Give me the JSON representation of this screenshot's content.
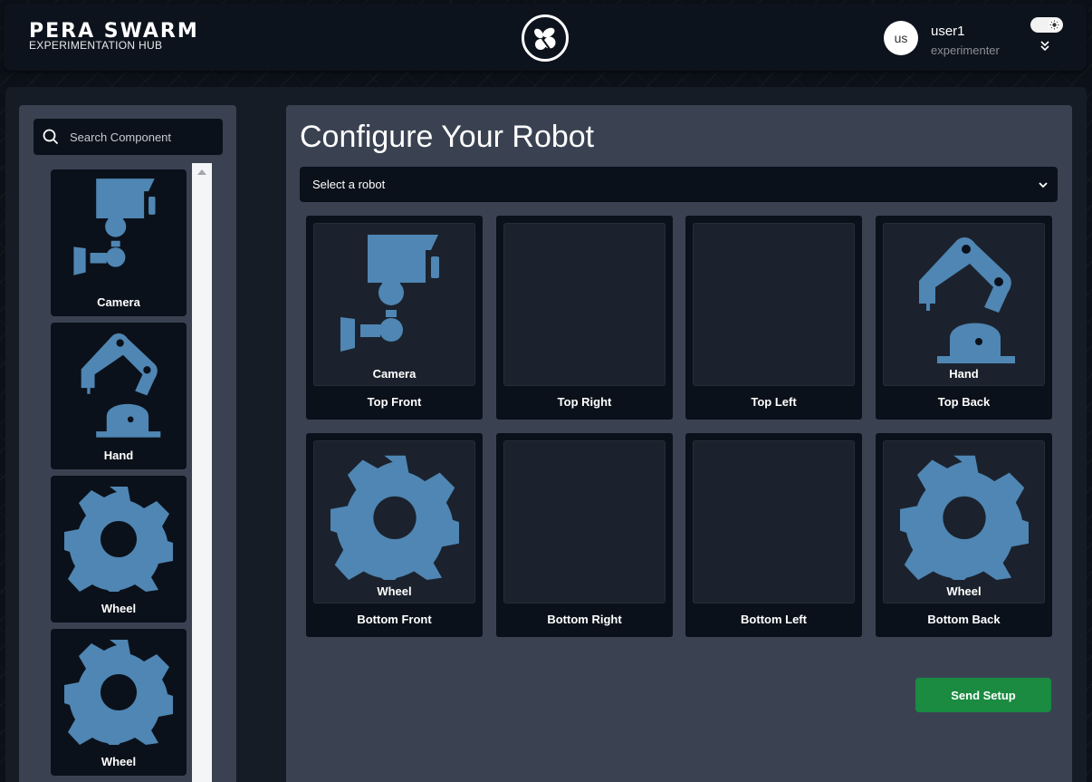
{
  "header": {
    "brand_title": "PERA SWARM",
    "brand_subtitle": "EXPERIMENTATION HUB",
    "avatar_initials": "us",
    "user_name": "user1",
    "user_role": "experimenter"
  },
  "sidebar": {
    "search_placeholder": "Search Component",
    "components": [
      {
        "label": "Camera",
        "icon": "camera-icon"
      },
      {
        "label": "Hand",
        "icon": "robot-arm-icon"
      },
      {
        "label": "Wheel",
        "icon": "gear-icon"
      },
      {
        "label": "Wheel",
        "icon": "gear-icon"
      }
    ]
  },
  "config": {
    "title": "Configure Your Robot",
    "select_value": "Select a robot",
    "slots": [
      {
        "label": "Top Front",
        "component": "Camera"
      },
      {
        "label": "Top Right",
        "component": ""
      },
      {
        "label": "Top Left",
        "component": ""
      },
      {
        "label": "Top Back",
        "component": "Hand"
      },
      {
        "label": "Bottom Front",
        "component": "Wheel"
      },
      {
        "label": "Bottom Right",
        "component": ""
      },
      {
        "label": "Bottom Left",
        "component": ""
      },
      {
        "label": "Bottom Back",
        "component": "Wheel"
      }
    ],
    "send_label": "Send Setup"
  },
  "colors": {
    "accent_icon": "#4f86b3",
    "panel": "#3a4252",
    "card": "#0b111a",
    "send_button": "#1a8b41"
  }
}
